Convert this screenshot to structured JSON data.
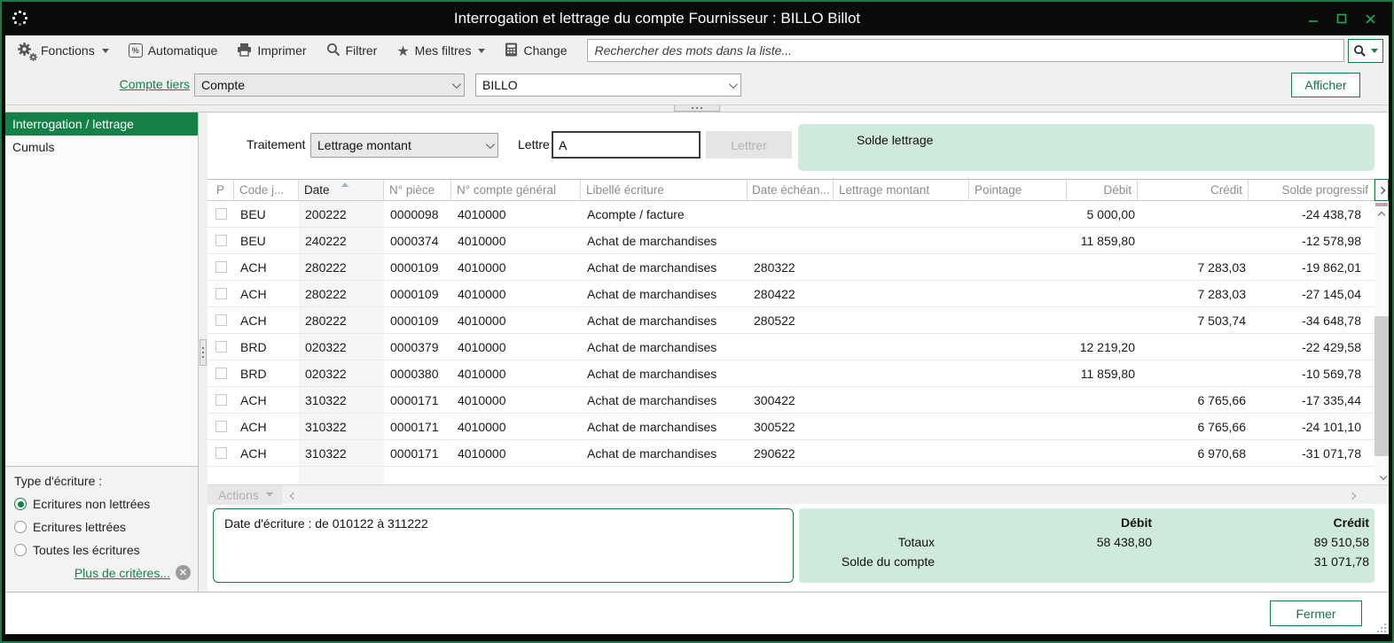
{
  "window": {
    "title": "Interrogation et lettrage du compte Fournisseur : BILLO Billot"
  },
  "toolbar": {
    "items": [
      {
        "label": "Fonctions",
        "icon": "gear-icon",
        "dropdown": true
      },
      {
        "label": "Automatique",
        "icon": "automatic-icon"
      },
      {
        "label": "Imprimer",
        "icon": "printer-icon"
      },
      {
        "label": "Filtrer",
        "icon": "magnifier-icon"
      },
      {
        "label": "Mes filtres",
        "icon": "star-icon",
        "dropdown": true
      },
      {
        "label": "Change",
        "icon": "calculator-icon"
      }
    ],
    "search": {
      "placeholder": "Rechercher des mots dans la liste..."
    }
  },
  "account_bar": {
    "link": "Compte tiers",
    "type_value": "Compte",
    "account_value": "BILLO",
    "show_button": "Afficher"
  },
  "sidebar": {
    "items": [
      {
        "label": "Interrogation / lettrage",
        "selected": true
      },
      {
        "label": "Cumuls",
        "selected": false
      }
    ],
    "filter": {
      "title": "Type d'écriture :",
      "options": [
        {
          "label": "Ecritures non lettrées",
          "selected": true
        },
        {
          "label": "Ecritures lettrées",
          "selected": false
        },
        {
          "label": "Toutes les écritures",
          "selected": false
        }
      ],
      "more_link": "Plus de critères..."
    }
  },
  "lettrage": {
    "traitement_label": "Traitement",
    "traitement_value": "Lettrage montant",
    "lettre_label": "Lettre",
    "lettre_value": "A",
    "lettrer_button": "Lettrer",
    "solde_label": "Solde lettrage"
  },
  "table": {
    "columns": [
      "P",
      "Code j...",
      "Date",
      "N° pièce",
      "N° compte général",
      "Libellé écriture",
      "Date échéan...",
      "Lettrage montant",
      "Pointage",
      "Débit",
      "Crédit",
      "Solde progressif"
    ],
    "sort_column_index": 2,
    "rows": [
      {
        "code": "BEU",
        "date": "200222",
        "piece": "0000098",
        "compte": "4010000",
        "libelle": "Acompte / facture",
        "echeance": "",
        "lettrage": "",
        "pointage": "",
        "debit": "5 000,00",
        "credit": "",
        "solde": "-24 438,78"
      },
      {
        "code": "BEU",
        "date": "240222",
        "piece": "0000374",
        "compte": "4010000",
        "libelle": "Achat de marchandises",
        "echeance": "",
        "lettrage": "",
        "pointage": "",
        "debit": "11 859,80",
        "credit": "",
        "solde": "-12 578,98"
      },
      {
        "code": "ACH",
        "date": "280222",
        "piece": "0000109",
        "compte": "4010000",
        "libelle": "Achat de marchandises",
        "echeance": "280322",
        "lettrage": "",
        "pointage": "",
        "debit": "",
        "credit": "7 283,03",
        "solde": "-19 862,01"
      },
      {
        "code": "ACH",
        "date": "280222",
        "piece": "0000109",
        "compte": "4010000",
        "libelle": "Achat de marchandises",
        "echeance": "280422",
        "lettrage": "",
        "pointage": "",
        "debit": "",
        "credit": "7 283,03",
        "solde": "-27 145,04"
      },
      {
        "code": "ACH",
        "date": "280222",
        "piece": "0000109",
        "compte": "4010000",
        "libelle": "Achat de marchandises",
        "echeance": "280522",
        "lettrage": "",
        "pointage": "",
        "debit": "",
        "credit": "7 503,74",
        "solde": "-34 648,78"
      },
      {
        "code": "BRD",
        "date": "020322",
        "piece": "0000379",
        "compte": "4010000",
        "libelle": "Achat de marchandises",
        "echeance": "",
        "lettrage": "",
        "pointage": "",
        "debit": "12 219,20",
        "credit": "",
        "solde": "-22 429,58"
      },
      {
        "code": "BRD",
        "date": "020322",
        "piece": "0000380",
        "compte": "4010000",
        "libelle": "Achat de marchandises",
        "echeance": "",
        "lettrage": "",
        "pointage": "",
        "debit": "11 859,80",
        "credit": "",
        "solde": "-10 569,78"
      },
      {
        "code": "ACH",
        "date": "310322",
        "piece": "0000171",
        "compte": "4010000",
        "libelle": "Achat de marchandises",
        "echeance": "300422",
        "lettrage": "",
        "pointage": "",
        "debit": "",
        "credit": "6 765,66",
        "solde": "-17 335,44"
      },
      {
        "code": "ACH",
        "date": "310322",
        "piece": "0000171",
        "compte": "4010000",
        "libelle": "Achat de marchandises",
        "echeance": "300522",
        "lettrage": "",
        "pointage": "",
        "debit": "",
        "credit": "6 765,66",
        "solde": "-24 101,10"
      },
      {
        "code": "ACH",
        "date": "310322",
        "piece": "0000171",
        "compte": "4010000",
        "libelle": "Achat de marchandises",
        "echeance": "290622",
        "lettrage": "",
        "pointage": "",
        "debit": "",
        "credit": "6 970,68",
        "solde": "-31 071,78"
      }
    ]
  },
  "actions_bar": {
    "label": "Actions"
  },
  "criteria": {
    "text": "Date d'écriture : de 010122 à 311222"
  },
  "totals": {
    "debit_header": "Débit",
    "credit_header": "Crédit",
    "rows": [
      {
        "label": "Totaux",
        "debit": "58 438,80",
        "credit": "89 510,58"
      },
      {
        "label": "Solde du compte",
        "debit": "",
        "credit": "31 071,78"
      }
    ]
  },
  "footer": {
    "close_button": "Fermer"
  },
  "colors": {
    "accent_green": "#158048",
    "panel_green": "#cfe9dc",
    "titlebar": "#0a0a0a"
  }
}
